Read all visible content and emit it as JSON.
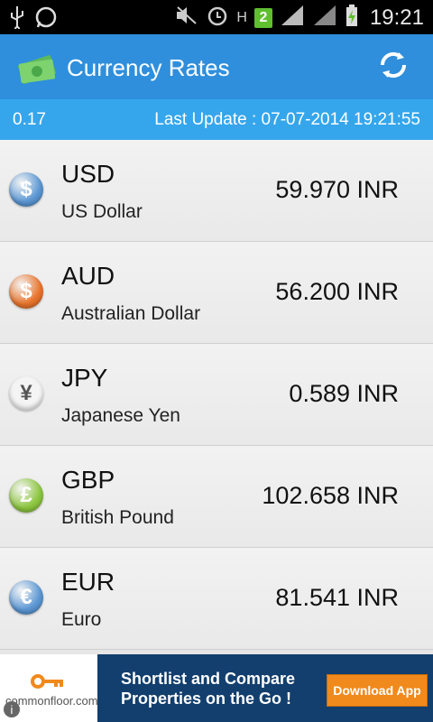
{
  "status_bar": {
    "time": "19:21",
    "badge": "2",
    "h_indicator": "H"
  },
  "app": {
    "title": "Currency Rates",
    "refresh_icon": "refresh-icon",
    "logo_icon": "money-icon"
  },
  "info_bar": {
    "count": "0.17",
    "last_update": "Last Update : 07-07-2014 19:21:55"
  },
  "currencies": [
    {
      "code": "USD",
      "name": "US Dollar",
      "rate": "59.970 INR",
      "symbol": "$",
      "color": "#5b97d4"
    },
    {
      "code": "AUD",
      "name": "Australian Dollar",
      "rate": "56.200 INR",
      "symbol": "$",
      "color": "#e8742c"
    },
    {
      "code": "JPY",
      "name": "Japanese Yen",
      "rate": "0.589 INR",
      "symbol": "¥",
      "color": "#f4f4f4"
    },
    {
      "code": "GBP",
      "name": "British Pound",
      "rate": "102.658 INR",
      "symbol": "£",
      "color": "#8cc63f"
    },
    {
      "code": "EUR",
      "name": "Euro",
      "rate": "81.541 INR",
      "symbol": "€",
      "color": "#5b97d4"
    }
  ],
  "ad": {
    "brand": "commonfloor.com",
    "headline_line1": "Shortlist and Compare",
    "headline_line2": "Properties on the Go !",
    "button": "Download App",
    "info_glyph": "i"
  },
  "colors": {
    "appbar": "#2f8fdc",
    "infobar": "#35a6ec",
    "ad_button": "#f08a1c"
  }
}
